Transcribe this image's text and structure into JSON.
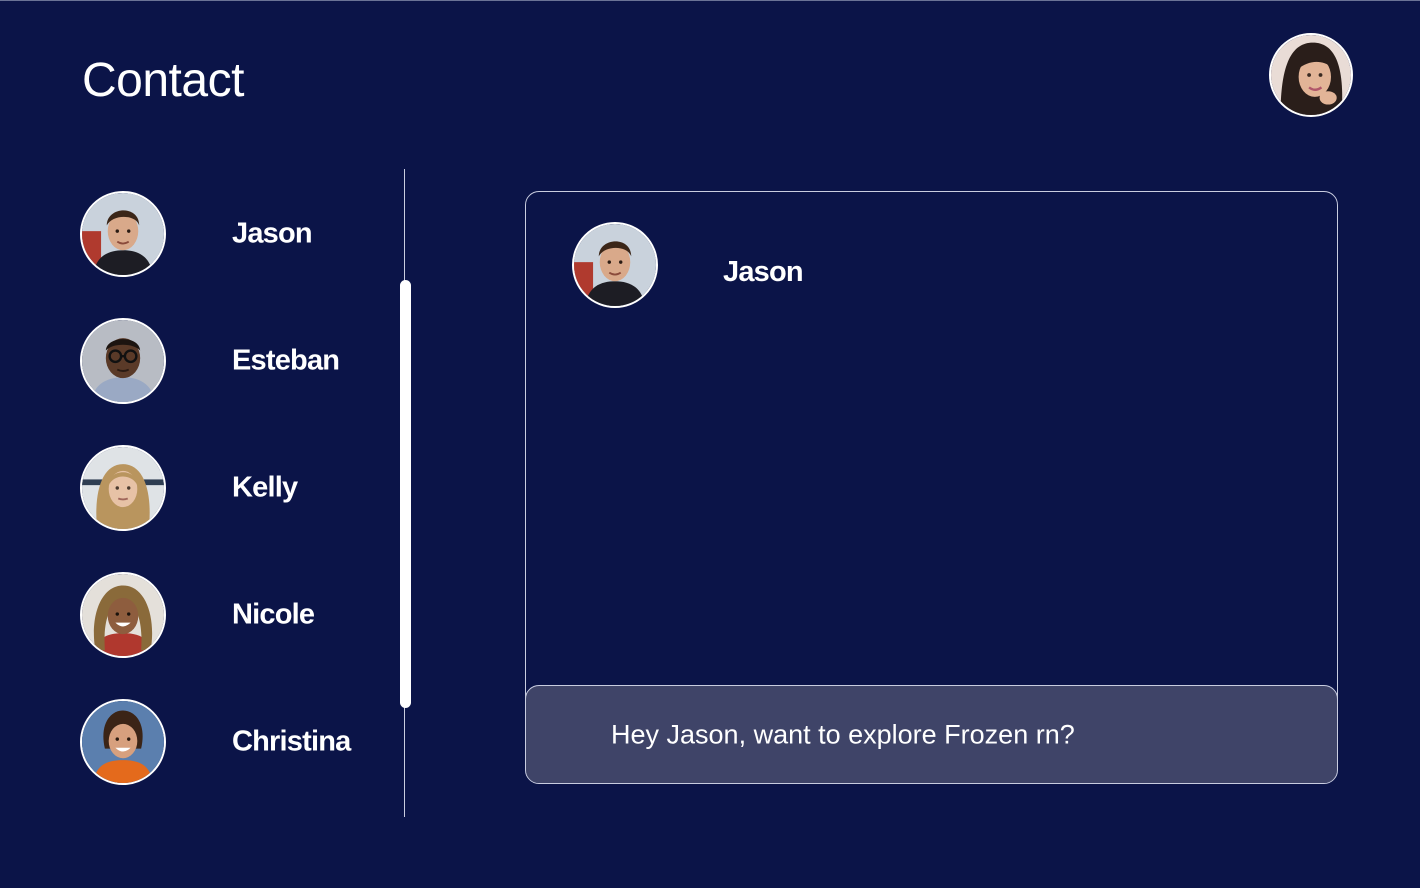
{
  "page": {
    "title": "Contact"
  },
  "user": {
    "avatar_icon": "user-avatar-icon"
  },
  "contacts": [
    {
      "name": "Jason"
    },
    {
      "name": "Esteban"
    },
    {
      "name": "Kelly"
    },
    {
      "name": "Nicole"
    },
    {
      "name": "Christina"
    }
  ],
  "chat": {
    "contact_name": "Jason",
    "message_draft": "Hey Jason, want to explore Frozen rn?"
  },
  "colors": {
    "background": "#0b1448",
    "message_bar": "#3f4468",
    "border": "#c9cde0",
    "text": "#ffffff"
  }
}
